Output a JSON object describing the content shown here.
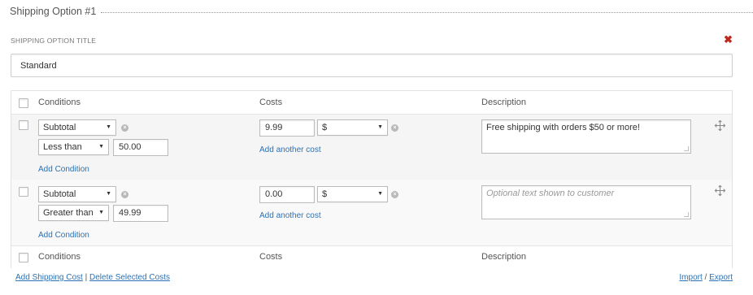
{
  "header": {
    "title": "Shipping Option #1"
  },
  "option": {
    "title_label": "SHIPPING OPTION TITLE",
    "title_value": "Standard",
    "remove_symbol": "✖"
  },
  "table": {
    "columns": {
      "conditions": "Conditions",
      "costs": "Costs",
      "description": "Description"
    },
    "rows": [
      {
        "condition_type": "Subtotal",
        "operator": "Less than",
        "condition_value": "50.00",
        "add_condition": "Add Condition",
        "cost_value": "9.99",
        "cost_unit": "$",
        "add_cost": "Add another cost",
        "description": "Free shipping with orders $50 or more!",
        "description_placeholder": ""
      },
      {
        "condition_type": "Subtotal",
        "operator": "Greater than",
        "condition_value": "49.99",
        "add_condition": "Add Condition",
        "cost_value": "0.00",
        "cost_unit": "$",
        "add_cost": "Add another cost",
        "description": "",
        "description_placeholder": "Optional text shown to customer"
      }
    ]
  },
  "footer": {
    "add_shipping_cost": "Add Shipping Cost",
    "separator": "|",
    "delete_selected": "Delete Selected Costs",
    "import": "Import",
    "slash": "/",
    "export": "Export"
  },
  "colors": {
    "link": "#2a72b5",
    "remove": "#c0281e",
    "row_bg": "#f5f5f5"
  },
  "icons": {
    "remove": "close-icon",
    "condition_remove": "remove-circle-icon",
    "drag": "move-arrows-icon",
    "dropdown": "caret-down-icon"
  }
}
